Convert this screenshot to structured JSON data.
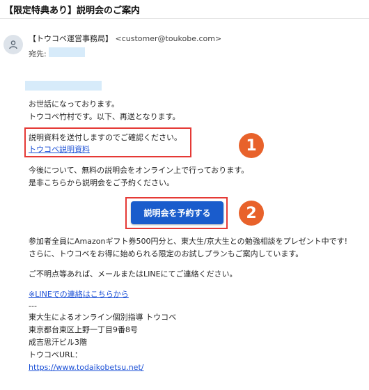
{
  "email": {
    "subject": "【限定特典あり】説明会のご案内",
    "sender_name": "【トウコベ運営事務局】",
    "sender_email": "<customer@toukobe.com>",
    "to_label": "宛先:",
    "greeting": "お世話になっております。",
    "intro": "トウコベ竹村です。以下、再送となります。",
    "material_text": "説明資料を送付しますのでご確認ください。",
    "material_link": "トウコベ説明資料",
    "seminar_line1": "今後について、無料の説明会をオンライン上で行っております。",
    "seminar_line2": "是非こちらから説明会をご予約ください。",
    "reserve_button": "説明会を予約する",
    "gift_line1": "参加者全員にAmazonギフト券500円分と、東大生/京大生との勉強相談をプレゼント中です!",
    "gift_line2": "さらに、トウコベをお得に始められる限定のお試しプランもご案内しています。",
    "contact_line": "ご不明点等あれば、メールまたはLINEにてご連絡ください。",
    "line_link": "※LINEでの連絡はこちらから",
    "sig_sep": "---",
    "sig_line1": "東大生によるオンライン個別指導 トウコベ",
    "sig_line2": "東京都台東区上野一丁目9番8号",
    "sig_line3": "成吉思汗ビル3階",
    "sig_url_label": "トウコベURL：",
    "sig_url": "https://www.todaikobetsu.net/"
  },
  "annotations": {
    "badge1": "1",
    "badge2": "2"
  },
  "colors": {
    "button": "#1a5ccc",
    "highlight_border": "#e53935",
    "badge": "#e8622b",
    "link": "#1a4fd6"
  }
}
